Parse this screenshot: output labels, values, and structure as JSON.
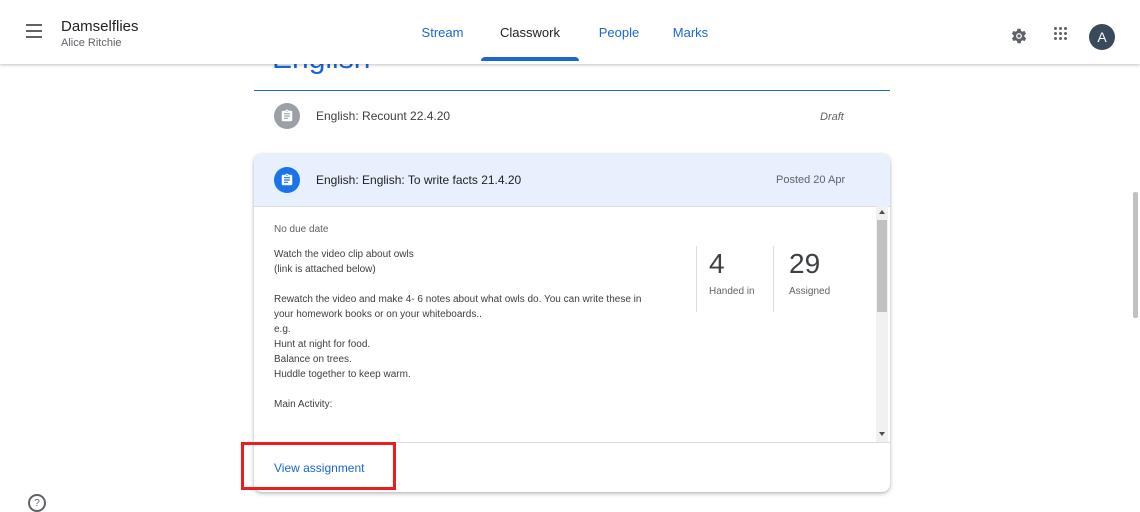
{
  "header": {
    "class_name": "Damselflies",
    "teacher": "Alice Ritchie",
    "tabs": [
      {
        "label": "Stream"
      },
      {
        "label": "Classwork"
      },
      {
        "label": "People"
      },
      {
        "label": "Marks"
      }
    ],
    "active_tab": "Classwork",
    "avatar_letter": "A"
  },
  "topic": {
    "title": "English"
  },
  "draft_item": {
    "title": "English: Recount 22.4.20",
    "status": "Draft"
  },
  "assignment": {
    "title": "English: English: To write facts 21.4.20",
    "posted": "Posted 20 Apr",
    "due": "No due date",
    "description_lines": [
      "Watch the video clip about owls",
      "(link is attached below)",
      "",
      "Rewatch the video and make 4- 6 notes about what owls do. You can write these in",
      "your homework books or on your whiteboards..",
      "e.g.",
      "Hunt at night for food.",
      "Balance on trees.",
      "Huddle together to keep warm.",
      "",
      "Main Activity:"
    ],
    "handed_in_count": "4",
    "handed_in_label": "Handed in",
    "assigned_count": "29",
    "assigned_label": "Assigned",
    "view_link": "View assignment"
  },
  "colors": {
    "accent": "#1967d2",
    "card_header_bg": "#e8f0fe",
    "highlight": "#ee1c1c"
  },
  "icons": {
    "menu": "menu-icon",
    "settings": "gear-icon",
    "apps": "apps-grid-icon",
    "assignment": "assignment-icon",
    "help": "help-icon"
  }
}
